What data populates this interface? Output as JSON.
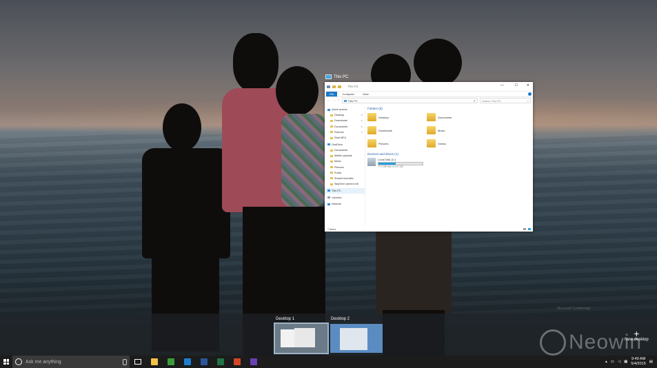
{
  "explorer": {
    "window_title": "This PC",
    "ribbon_tabs": [
      "File",
      "Computer",
      "View"
    ],
    "address": "This PC",
    "address_crumb": "This PC",
    "search_placeholder": "Search This PC",
    "nav": [
      {
        "label": "Quick access",
        "level": "top",
        "pinned": false,
        "icon": "star-icon"
      },
      {
        "label": "Desktop",
        "level": "sub",
        "pinned": true,
        "icon": "folder-icon"
      },
      {
        "label": "Downloads",
        "level": "sub",
        "pinned": true,
        "icon": "folder-icon"
      },
      {
        "label": "Documents",
        "level": "sub",
        "pinned": true,
        "icon": "folder-icon"
      },
      {
        "label": "Pictures",
        "level": "sub",
        "pinned": true,
        "icon": "folder-icon"
      },
      {
        "label": "Start MFU",
        "level": "sub",
        "pinned": false,
        "icon": "folder-icon"
      },
      {
        "label": "OneDrive",
        "level": "top",
        "pinned": false,
        "icon": "cloud-icon"
      },
      {
        "label": "Documents",
        "level": "sub",
        "pinned": false,
        "icon": "folder-icon"
      },
      {
        "label": "Mobile uploads",
        "level": "sub",
        "pinned": false,
        "icon": "folder-icon"
      },
      {
        "label": "Music",
        "level": "sub",
        "pinned": false,
        "icon": "folder-icon"
      },
      {
        "label": "Pictures",
        "level": "sub",
        "pinned": false,
        "icon": "folder-icon"
      },
      {
        "label": "Public",
        "level": "sub",
        "pinned": false,
        "icon": "folder-icon"
      },
      {
        "label": "Shared favorites",
        "level": "sub",
        "pinned": false,
        "icon": "folder-icon"
      },
      {
        "label": "SkyDrive camera roll",
        "level": "sub",
        "pinned": false,
        "icon": "folder-icon"
      },
      {
        "label": "This PC",
        "level": "top",
        "pinned": false,
        "icon": "computer-icon",
        "selected": true
      },
      {
        "label": "Libraries",
        "level": "top",
        "pinned": false,
        "icon": "library-icon"
      },
      {
        "label": "Network",
        "level": "top",
        "pinned": false,
        "icon": "network-icon"
      }
    ],
    "folders_header": "Folders (6)",
    "folders": [
      "Desktop",
      "Documents",
      "Downloads",
      "Music",
      "Pictures",
      "Videos"
    ],
    "devices_header": "Devices and drives (1)",
    "drive": {
      "name": "Local Disk (C:)",
      "free": "77.0 GB free of 127 GB",
      "used_fraction": 0.39
    },
    "status": "7 items"
  },
  "taskview": {
    "desktops": [
      "Desktop 1",
      "Desktop 2"
    ],
    "new_desktop": "New desktop"
  },
  "watermark": {
    "text": "Neowin",
    "confidential": "Microsoft Confidential"
  },
  "taskbar": {
    "search_placeholder": "Ask me anything",
    "time": "9:49 AM",
    "date": "5/4/2015",
    "apps": [
      {
        "name": "file-explorer-icon",
        "color": "#f2c34a"
      },
      {
        "name": "store-icon",
        "color": "#3a9d3a"
      },
      {
        "name": "ie-icon",
        "color": "#1e7fd1"
      },
      {
        "name": "word-icon",
        "color": "#2b579a"
      },
      {
        "name": "excel-icon",
        "color": "#217346"
      },
      {
        "name": "powerpoint-icon",
        "color": "#d24726"
      },
      {
        "name": "calendar-icon",
        "color": "#6b3fb5"
      }
    ]
  }
}
